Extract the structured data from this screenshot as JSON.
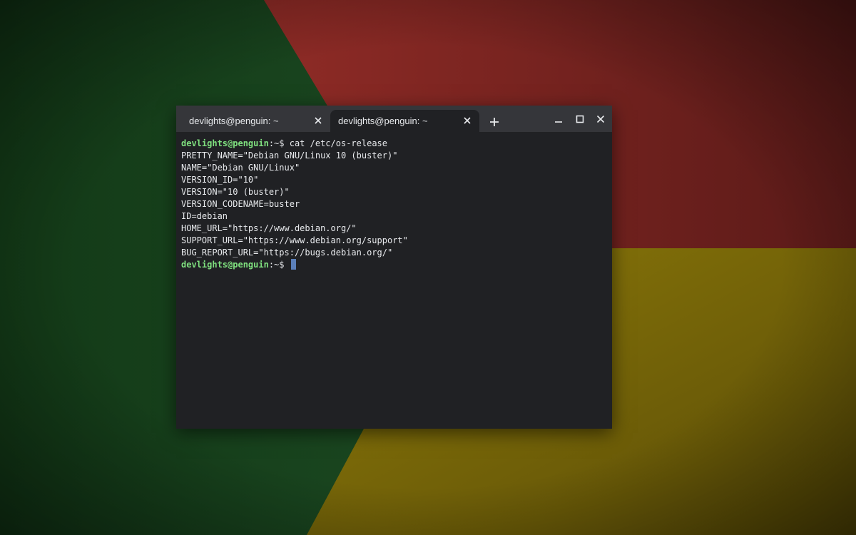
{
  "colors": {
    "wallpaper_green": "#1f4a24",
    "wallpaper_red": "#8a2a26",
    "wallpaper_yellow": "#8a7a0a",
    "titlebar": "#35363a",
    "terminal_bg": "#202124",
    "prompt_user": "#7fe07f",
    "cursor": "#5b7fb9"
  },
  "tabs": [
    {
      "title": "devlights@penguin: ~",
      "close_icon": "close-icon",
      "active": false
    },
    {
      "title": "devlights@penguin: ~",
      "close_icon": "close-icon",
      "active": true
    }
  ],
  "window_controls": {
    "new_tab_icon": "plus-icon",
    "minimize_icon": "minimize-icon",
    "maximize_icon": "maximize-icon",
    "close_icon": "close-icon"
  },
  "terminal": {
    "prompt_user": "devlights@penguin",
    "prompt_suffix": ":~$ ",
    "command": "cat /etc/os-release",
    "output": [
      "PRETTY_NAME=\"Debian GNU/Linux 10 (buster)\"",
      "NAME=\"Debian GNU/Linux\"",
      "VERSION_ID=\"10\"",
      "VERSION=\"10 (buster)\"",
      "VERSION_CODENAME=buster",
      "ID=debian",
      "HOME_URL=\"https://www.debian.org/\"",
      "SUPPORT_URL=\"https://www.debian.org/support\"",
      "BUG_REPORT_URL=\"https://bugs.debian.org/\""
    ]
  }
}
